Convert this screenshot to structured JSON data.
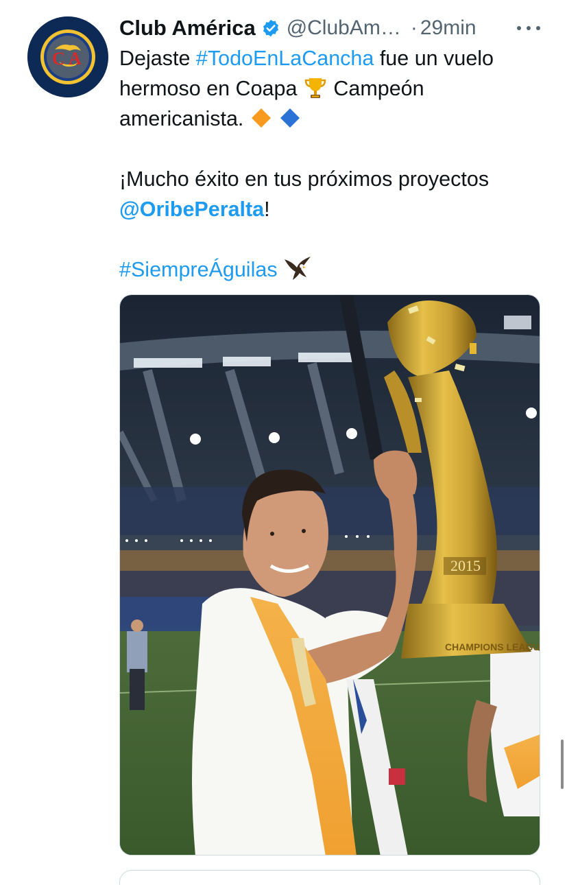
{
  "tweet": {
    "author": {
      "name": "Club América",
      "handle": "@ClubAm…",
      "time_sep": "·",
      "time": "29min",
      "avatar_icon": "club-america-crest-icon",
      "verified_icon": "verified-badge-icon"
    },
    "text": {
      "l1_a": "Dejaste ",
      "l1_hashtag": "#TodoEnLaCancha",
      "l1_b": " fue un vuelo",
      "l2_a": "hermoso en Coapa ",
      "l2_b": " Campeón",
      "l3_a": "americanista. ",
      "l5": "¡Mucho éxito en tus próximos proyectos",
      "l6_mention": "@OribePeralta",
      "l6_b": "!",
      "l8_hashtag": "#SiempreÁguilas"
    },
    "emojis": [
      "trophy-icon",
      "orange-diamond-icon",
      "blue-diamond-icon",
      "eagle-icon"
    ],
    "media": {
      "icon": "photo-player-with-trophy",
      "trophy_year": "2015",
      "trophy_text": "CHAMPIONS LEAGUE"
    }
  },
  "colors": {
    "link": "#1d9bf0",
    "text": "#0f1419",
    "secondary": "#536471"
  }
}
